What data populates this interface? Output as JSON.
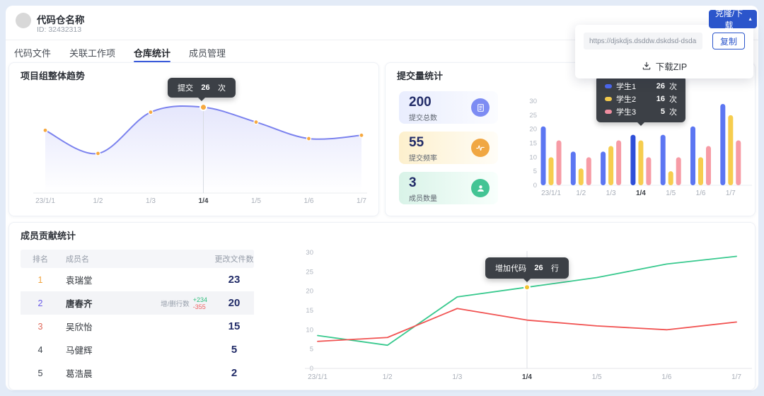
{
  "header": {
    "title": "代码仓名称",
    "id_text": "ID: 32432313",
    "clone_label": "克隆/下载",
    "clone_caret": "▲"
  },
  "tabs": [
    {
      "id": "code-files",
      "label": "代码文件",
      "active": false
    },
    {
      "id": "linked-workitems",
      "label": "关联工作项",
      "active": false
    },
    {
      "id": "repo-stats",
      "label": "仓库统计",
      "active": true
    },
    {
      "id": "member-management",
      "label": "成员管理",
      "active": false
    }
  ],
  "dropdown": {
    "url": "https://djskdjs.dsddw.dskdsd-dsdare",
    "copy_label": "复制",
    "zip_label": "下载ZIP"
  },
  "trend_card": {
    "title": "项目组整体趋势",
    "tooltip": {
      "label": "提交",
      "value": "26",
      "unit": "次"
    }
  },
  "commit_card": {
    "title": "提交量统计",
    "stats": [
      {
        "value": "200",
        "label": "提交总数",
        "icon": "doc-icon",
        "theme": "blue"
      },
      {
        "value": "55",
        "label": "提交频率",
        "icon": "pulse-icon",
        "theme": "yellow"
      },
      {
        "value": "3",
        "label": "成员数量",
        "icon": "user-icon",
        "theme": "green"
      }
    ],
    "tooltip": {
      "rows": [
        {
          "name": "学生1",
          "value": "26",
          "unit": "次",
          "color": "#4d68f0"
        },
        {
          "name": "学生2",
          "value": "16",
          "unit": "次",
          "color": "#f2c94c"
        },
        {
          "name": "学生3",
          "value": "5",
          "unit": "次",
          "color": "#f08ea0"
        }
      ]
    }
  },
  "contrib_card": {
    "title": "成员贡献统计",
    "table": {
      "headers": [
        "排名",
        "成员名",
        "更改文件数"
      ],
      "rows": [
        {
          "rank": "1",
          "rank_color": "#f0a33c",
          "name": "袁瑞堂",
          "value": "23",
          "highlight": false
        },
        {
          "rank": "2",
          "rank_color": "#6a5ce8",
          "name": "唐春齐",
          "value": "20",
          "highlight": true,
          "extra": {
            "label": "增/删行数",
            "add": "+234",
            "del": "-355"
          }
        },
        {
          "rank": "3",
          "rank_color": "#e0695a",
          "name": "吴欣怡",
          "value": "15",
          "highlight": false
        },
        {
          "rank": "4",
          "rank_color": "#3d434c",
          "name": "马健辉",
          "value": "5",
          "highlight": false
        },
        {
          "rank": "5",
          "rank_color": "#3d434c",
          "name": "葛浩晨",
          "value": "2",
          "highlight": false
        }
      ]
    },
    "tooltip": {
      "label": "增加代码",
      "value": "26",
      "unit": "行"
    }
  },
  "chart_data": [
    {
      "id": "trend",
      "type": "line",
      "title": "项目组整体趋势",
      "x": [
        "23/1/1",
        "1/2",
        "1/3",
        "1/4",
        "1/5",
        "1/6",
        "1/7"
      ],
      "series": [
        {
          "name": "提交",
          "color": "#7b82ee",
          "values": [
            19,
            12,
            24.5,
            26,
            21.5,
            16.5,
            17.5
          ]
        }
      ],
      "ylim": [
        0,
        30
      ],
      "highlight_x": "1/4",
      "point_color": "#f6a940",
      "smooth": true,
      "area_fill": true,
      "unit": "次"
    },
    {
      "id": "commits",
      "type": "bar",
      "title": "提交量统计",
      "x": [
        "23/1/1",
        "1/2",
        "1/3",
        "1/4",
        "1/5",
        "1/6",
        "1/7"
      ],
      "series": [
        {
          "name": "学生1",
          "color": "#5c76f2",
          "highlight_color": "#2e4ed8",
          "values": [
            21,
            12,
            12,
            18,
            18,
            21,
            29
          ]
        },
        {
          "name": "学生2",
          "color": "#f6cd4e",
          "values": [
            10,
            6,
            14,
            16,
            5,
            10,
            25
          ]
        },
        {
          "name": "学生3",
          "color": "#f79ba5",
          "values": [
            16,
            10,
            16,
            10,
            10,
            14,
            16
          ]
        }
      ],
      "ylim": [
        0,
        30
      ],
      "yticks": [
        0,
        5,
        10,
        15,
        20,
        25,
        30
      ],
      "highlight_x": "1/4",
      "unit": "次"
    },
    {
      "id": "contrib",
      "type": "line",
      "title": "成员贡献统计",
      "x": [
        "23/1/1",
        "1/2",
        "1/3",
        "1/4",
        "1/5",
        "1/6",
        "1/7"
      ],
      "series": [
        {
          "name": "增加代码",
          "color": "#38c98e",
          "values": [
            8.5,
            6,
            18.5,
            21,
            23.5,
            27,
            29
          ]
        },
        {
          "name": "",
          "color": "#f15352",
          "values": [
            7,
            8,
            15.5,
            12.5,
            11,
            10,
            12
          ]
        }
      ],
      "ylim": [
        0,
        30
      ],
      "yticks": [
        0,
        5,
        10,
        15,
        20,
        25,
        30
      ],
      "highlight_x": "1/4",
      "highlight_point": {
        "series": 0,
        "x": "1/4",
        "color": "#f2c230"
      },
      "unit": "行"
    }
  ]
}
